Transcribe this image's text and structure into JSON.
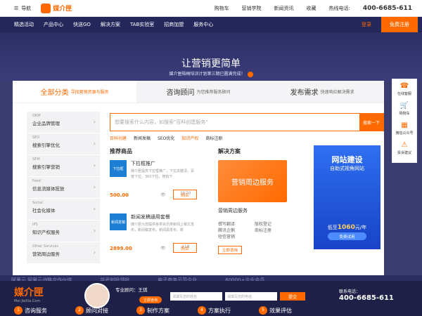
{
  "top": {
    "nav": "导航",
    "logo": "媒介匣",
    "links": [
      "购物车",
      "营销学院",
      "新闻资讯",
      "收藏"
    ],
    "hotline_label": "热线电话:",
    "hotline": "400-6685-611"
  },
  "menu": {
    "items": [
      "精选活动",
      "产品中心",
      "快送GO",
      "解决方案",
      "TAB实验室",
      "招商加盟",
      "服务中心"
    ],
    "login": "登录",
    "register": "免费注册"
  },
  "hero": {
    "title": "让营销更简单",
    "subtitle": "媒介匣梧桐培训计划第三期已圆满完成！"
  },
  "tabs": [
    {
      "label": "全部分类",
      "hint": "寻找营销资源与服务"
    },
    {
      "label": "咨询顾问",
      "hint": "为您推荐服务顾问"
    },
    {
      "label": "发布需求",
      "hint": "快速响应解决需求"
    }
  ],
  "sidebar": [
    {
      "en": "ORM",
      "cn": "企业品牌管理"
    },
    {
      "en": "SEO",
      "cn": "搜索引擎优化"
    },
    {
      "en": "SEM",
      "cn": "搜索引擎营销"
    },
    {
      "en": "Feed",
      "cn": "信息流媒体投放"
    },
    {
      "en": "Social",
      "cn": "社会化媒体"
    },
    {
      "en": "IPS",
      "cn": "知识产权服务"
    },
    {
      "en": "Other Services",
      "cn": "营销周边服务"
    }
  ],
  "search": {
    "placeholder": "想要搜索什么内容，如搜索\"百科创建服务\"",
    "button": "搜索一下"
  },
  "hot": [
    {
      "t": "百科创建",
      "h": true
    },
    {
      "t": "新闻发稿",
      "h": false
    },
    {
      "t": "SEO优化",
      "h": false
    },
    {
      "t": "知识产权",
      "h": true
    },
    {
      "t": "商标注册",
      "h": false
    }
  ],
  "products_title": "推荐商品",
  "products": [
    {
      "img": "下拉框",
      "title": "下拉框推广",
      "desc": "媒介匣提供下拉框推广，下拉关键词，百度下拉，360下拉，搜狗下",
      "price": "500.00",
      "views": "1570",
      "buy": "购买"
    },
    {
      "img": "新闻发稿",
      "title": "新闻发稿通用套餐",
      "desc": "媒介匣为您提供各类资讯类新闻上稿文发布，新闻稿发布，新闻源发布，新",
      "price": "2899.00",
      "views": "218",
      "buy": "购买"
    }
  ],
  "solution": {
    "title": "解决方案",
    "img": "营销周边服务",
    "name": "营销周边服务",
    "col1": [
      "撰写翻译",
      "腾讯企鹅",
      "短信营销"
    ],
    "col2": [
      "版权登记",
      "商标注册"
    ],
    "consult": "立即咨询"
  },
  "banner": {
    "t1": "网站建设",
    "t2": "自助式视角网站",
    "price_label": "低至",
    "price": "1060",
    "unit": "元/年",
    "try": "免费试用"
  },
  "float": [
    "在线客服",
    "购物车",
    "微信公众号",
    "投诉建议"
  ],
  "partners": [
    "阿里云 阿里云战略合作伙伴",
    "华武创投领投",
    "电子商务示范企业",
    "60000+企业会员"
  ],
  "footer": {
    "logo": "媒介匣",
    "domain": "Mei JieXia.Com",
    "agent": "专业顾问：王琪",
    "advise": "立即咨询",
    "in1": "请填写您的姓名",
    "in2": "请填写您的电话",
    "submit": "提交",
    "contact_label": "联系电话：",
    "contact": "400-6685-611",
    "steps": [
      "咨询服务",
      "顾问对接",
      "制作方案",
      "方案执行",
      "效果评估"
    ]
  },
  "colors": {
    "accent": "#ff6a00",
    "nav": "#24275a",
    "banner": "#2f6ff0"
  }
}
